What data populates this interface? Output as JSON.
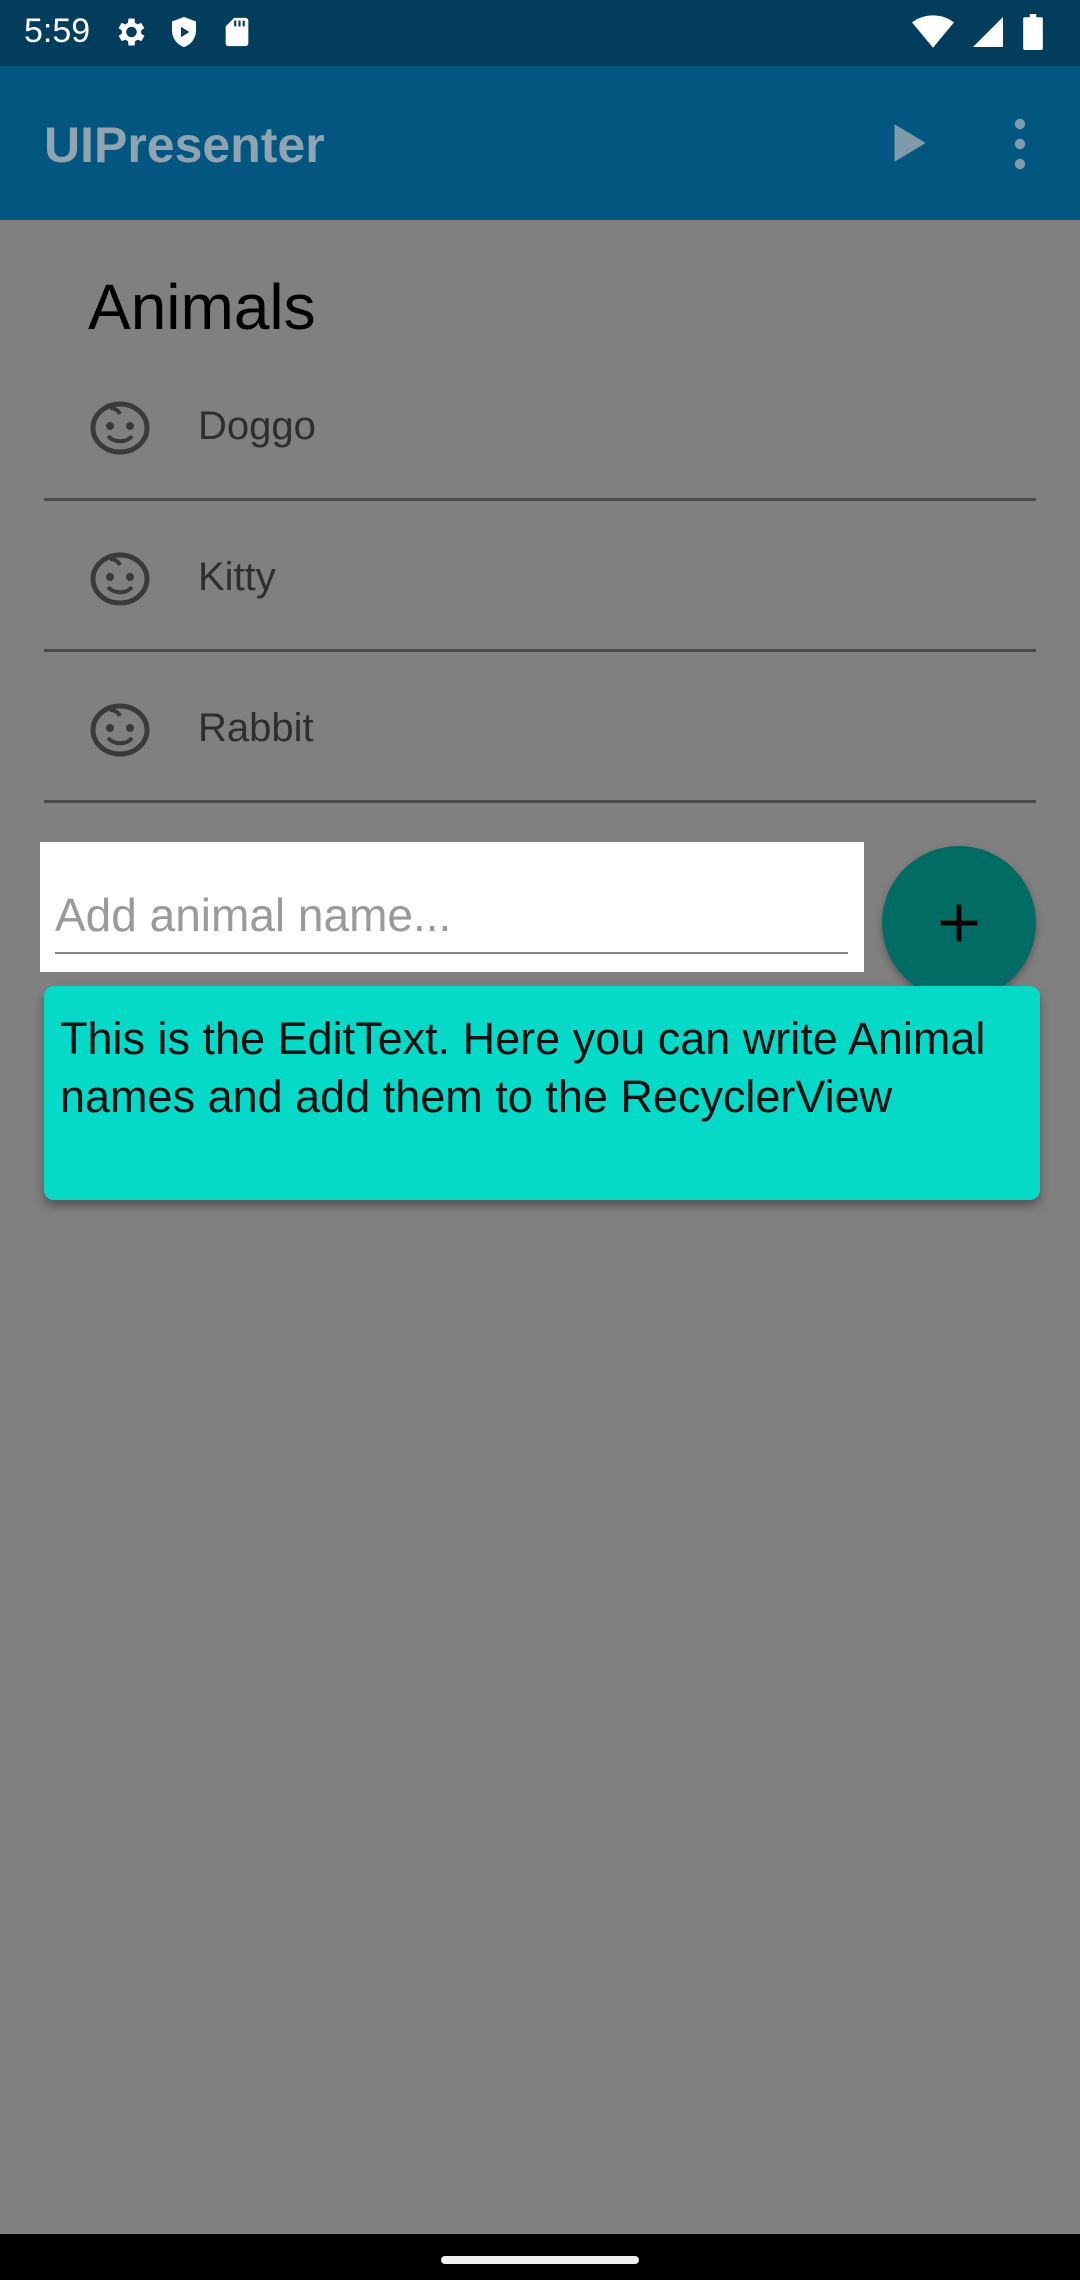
{
  "status_bar": {
    "time": "5:59",
    "icons_left": [
      "gear-icon",
      "shield-icon",
      "sd-card-icon"
    ],
    "icons_right": [
      "wifi-icon",
      "signal-icon",
      "battery-icon"
    ]
  },
  "app_bar": {
    "title": "UIPresenter",
    "actions": [
      "play-icon",
      "more-vert-icon"
    ]
  },
  "main": {
    "section_title": "Animals",
    "animals": [
      {
        "name": "Doggo",
        "icon": "face-icon"
      },
      {
        "name": "Kitty",
        "icon": "face-icon"
      },
      {
        "name": "Rabbit",
        "icon": "face-icon"
      }
    ],
    "input": {
      "placeholder": "Add animal name...",
      "value": ""
    },
    "fab_icon": "plus-icon",
    "tooltip": {
      "text": "This is the EditText. Here you can write Animal names and add them to the RecyclerView"
    }
  },
  "colors": {
    "status_bar": "#023d5e",
    "app_bar": "#025680",
    "scrim": "#808080",
    "fab": "#006c63",
    "tooltip": "#05d9c7"
  }
}
